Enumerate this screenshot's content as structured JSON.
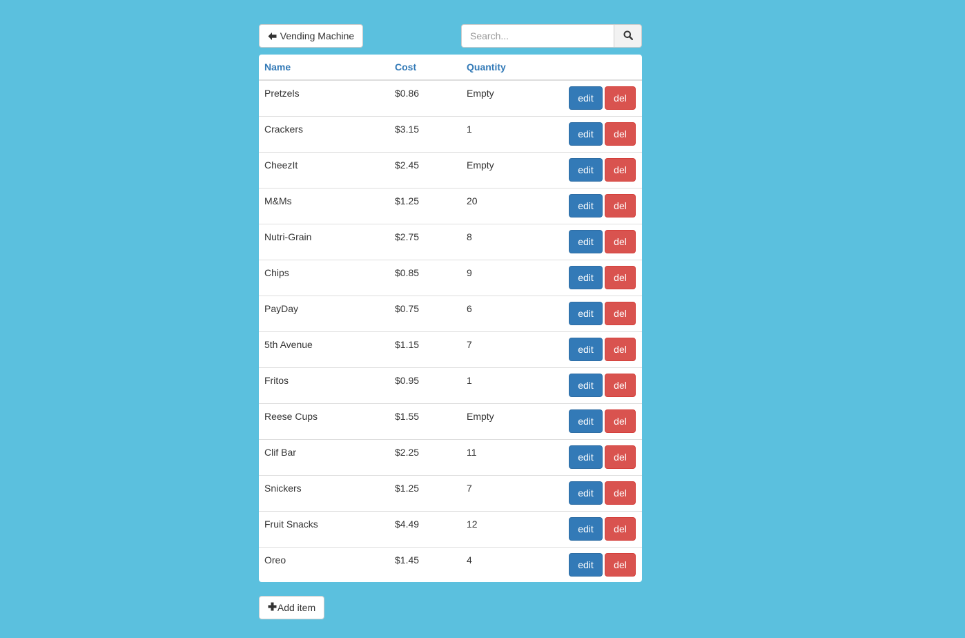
{
  "header": {
    "back_label": "Vending Machine",
    "search_placeholder": "Search...",
    "back_icon": "arrow-left-icon",
    "search_icon": "search-icon"
  },
  "table": {
    "columns": [
      "Name",
      "Cost",
      "Quantity"
    ],
    "edit_label": "edit",
    "delete_label": "del",
    "rows": [
      {
        "name": "Pretzels",
        "cost": "$0.86",
        "quantity": "Empty"
      },
      {
        "name": "Crackers",
        "cost": "$3.15",
        "quantity": "1"
      },
      {
        "name": "CheezIt",
        "cost": "$2.45",
        "quantity": "Empty"
      },
      {
        "name": "M&Ms",
        "cost": "$1.25",
        "quantity": "20"
      },
      {
        "name": "Nutri-Grain",
        "cost": "$2.75",
        "quantity": "8"
      },
      {
        "name": "Chips",
        "cost": "$0.85",
        "quantity": "9"
      },
      {
        "name": "PayDay",
        "cost": "$0.75",
        "quantity": "6"
      },
      {
        "name": "5th Avenue",
        "cost": "$1.15",
        "quantity": "7"
      },
      {
        "name": "Fritos",
        "cost": "$0.95",
        "quantity": "1"
      },
      {
        "name": "Reese Cups",
        "cost": "$1.55",
        "quantity": "Empty"
      },
      {
        "name": "Clif Bar",
        "cost": "$2.25",
        "quantity": "11"
      },
      {
        "name": "Snickers",
        "cost": "$1.25",
        "quantity": "7"
      },
      {
        "name": "Fruit Snacks",
        "cost": "$4.49",
        "quantity": "12"
      },
      {
        "name": "Oreo",
        "cost": "$1.45",
        "quantity": "4"
      }
    ]
  },
  "footer": {
    "add_label": "Add item",
    "add_icon": "plus-icon"
  },
  "colors": {
    "background": "#5bc0de",
    "primary": "#337ab7",
    "danger": "#d9534f"
  }
}
